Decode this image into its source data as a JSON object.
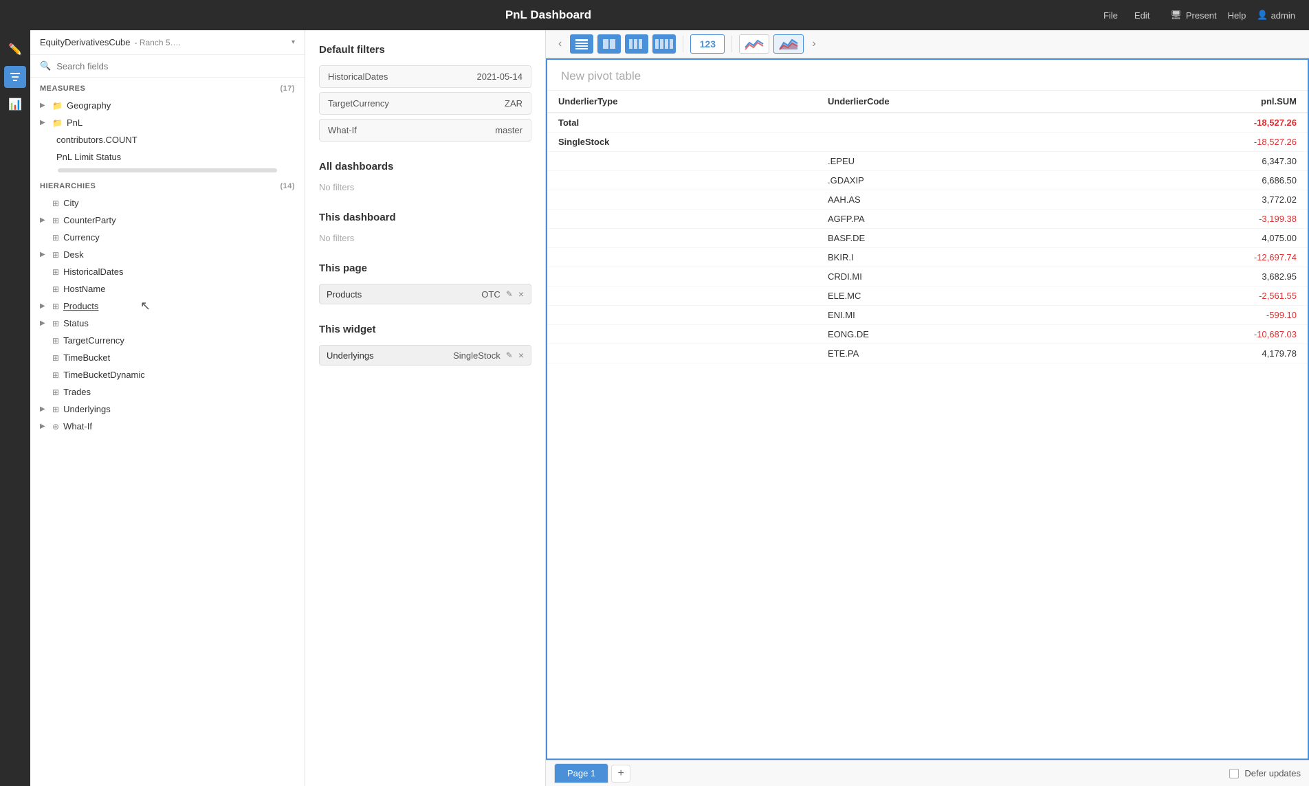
{
  "topbar": {
    "title": "PnL Dashboard",
    "menu_file": "File",
    "menu_edit": "Edit",
    "present_label": "Present",
    "help_label": "Help",
    "admin_label": "admin"
  },
  "cube_selector": {
    "name": "EquityDerivativesCube",
    "sub": "- Ranch 5….",
    "expand_icon": "▾"
  },
  "search": {
    "placeholder": "Search fields",
    "icon": "🔍"
  },
  "measures": {
    "label": "MEASURES",
    "count": "(17)",
    "items": [
      {
        "name": "Geography",
        "indent": false,
        "expandable": true,
        "type": "folder"
      },
      {
        "name": "PnL",
        "indent": false,
        "expandable": true,
        "type": "folder"
      },
      {
        "name": "contributors.COUNT",
        "indent": false,
        "expandable": false,
        "type": "none"
      },
      {
        "name": "PnL Limit Status",
        "indent": false,
        "expandable": false,
        "type": "none"
      }
    ]
  },
  "hierarchies": {
    "label": "HIERARCHIES",
    "count": "(14)",
    "items": [
      {
        "name": "City",
        "expandable": false,
        "type": "hierarchy"
      },
      {
        "name": "CounterParty",
        "expandable": true,
        "type": "hierarchy"
      },
      {
        "name": "Currency",
        "expandable": false,
        "type": "hierarchy"
      },
      {
        "name": "Desk",
        "expandable": true,
        "type": "hierarchy"
      },
      {
        "name": "HistoricalDates",
        "expandable": false,
        "type": "hierarchy"
      },
      {
        "name": "HostName",
        "expandable": false,
        "type": "hierarchy"
      },
      {
        "name": "Products",
        "expandable": true,
        "type": "hierarchy",
        "underlined": true,
        "cursor": true
      },
      {
        "name": "Status",
        "expandable": true,
        "type": "hierarchy"
      },
      {
        "name": "TargetCurrency",
        "expandable": false,
        "type": "hierarchy"
      },
      {
        "name": "TimeBucket",
        "expandable": false,
        "type": "hierarchy"
      },
      {
        "name": "TimeBucketDynamic",
        "expandable": false,
        "type": "hierarchy"
      },
      {
        "name": "Trades",
        "expandable": false,
        "type": "hierarchy"
      },
      {
        "name": "Underlyings",
        "expandable": true,
        "type": "hierarchy"
      },
      {
        "name": "What-If",
        "expandable": true,
        "type": "what-if"
      }
    ]
  },
  "filters": {
    "default_filters": {
      "title": "Default filters",
      "rows": [
        {
          "key": "HistoricalDates",
          "value": "2021-05-14"
        },
        {
          "key": "TargetCurrency",
          "value": "ZAR"
        },
        {
          "key": "What-If",
          "value": "master"
        }
      ]
    },
    "all_dashboards": {
      "title": "All dashboards",
      "no_filters": "No filters"
    },
    "this_dashboard": {
      "title": "This dashboard",
      "no_filters": "No filters"
    },
    "this_page": {
      "title": "This page",
      "chip": {
        "label": "Products",
        "value": "OTC",
        "edit_icon": "✎",
        "remove_icon": "×"
      }
    },
    "this_widget": {
      "title": "This widget",
      "chip": {
        "label": "Underlyings",
        "value": "SingleStock",
        "edit_icon": "✎",
        "remove_icon": "×"
      }
    }
  },
  "pivot": {
    "title": "New pivot table",
    "columns": [
      {
        "id": "underlier_type",
        "label": "UnderlierType"
      },
      {
        "id": "underlier_code",
        "label": "UnderlierCode"
      },
      {
        "id": "pnl_sum",
        "label": "pnl.SUM"
      }
    ],
    "rows": [
      {
        "type": "total",
        "col1": "Total",
        "col2": "",
        "col3": "-18,527.26",
        "negative": true
      },
      {
        "type": "section",
        "col1": "SingleStock",
        "col2": "",
        "col3": "-18,527.26",
        "negative": true
      },
      {
        "type": "data",
        "col1": "",
        "col2": ".EPEU",
        "col3": "6,347.30",
        "negative": false
      },
      {
        "type": "data",
        "col1": "",
        "col2": ".GDAXIP",
        "col3": "6,686.50",
        "negative": false
      },
      {
        "type": "data",
        "col1": "",
        "col2": "AAH.AS",
        "col3": "3,772.02",
        "negative": false
      },
      {
        "type": "data",
        "col1": "",
        "col2": "AGFP.PA",
        "col3": "-3,199.38",
        "negative": true
      },
      {
        "type": "data",
        "col1": "",
        "col2": "BASF.DE",
        "col3": "4,075.00",
        "negative": false
      },
      {
        "type": "data",
        "col1": "",
        "col2": "BKIR.I",
        "col3": "-12,697.74",
        "negative": true
      },
      {
        "type": "data",
        "col1": "",
        "col2": "CRDI.MI",
        "col3": "3,682.95",
        "negative": false
      },
      {
        "type": "data",
        "col1": "",
        "col2": "ELE.MC",
        "col3": "-2,561.55",
        "negative": true
      },
      {
        "type": "data",
        "col1": "",
        "col2": "ENI.MI",
        "col3": "-599.10",
        "negative": true
      },
      {
        "type": "data",
        "col1": "",
        "col2": "EONG.DE",
        "col3": "-10,687.03",
        "negative": true
      },
      {
        "type": "data",
        "col1": "",
        "col2": "ETE.PA",
        "col3": "4,179.78",
        "negative": false
      }
    ]
  },
  "tabs": {
    "pages": [
      {
        "label": "Page 1",
        "active": true
      }
    ],
    "add_label": "+",
    "defer_label": "Defer updates"
  }
}
